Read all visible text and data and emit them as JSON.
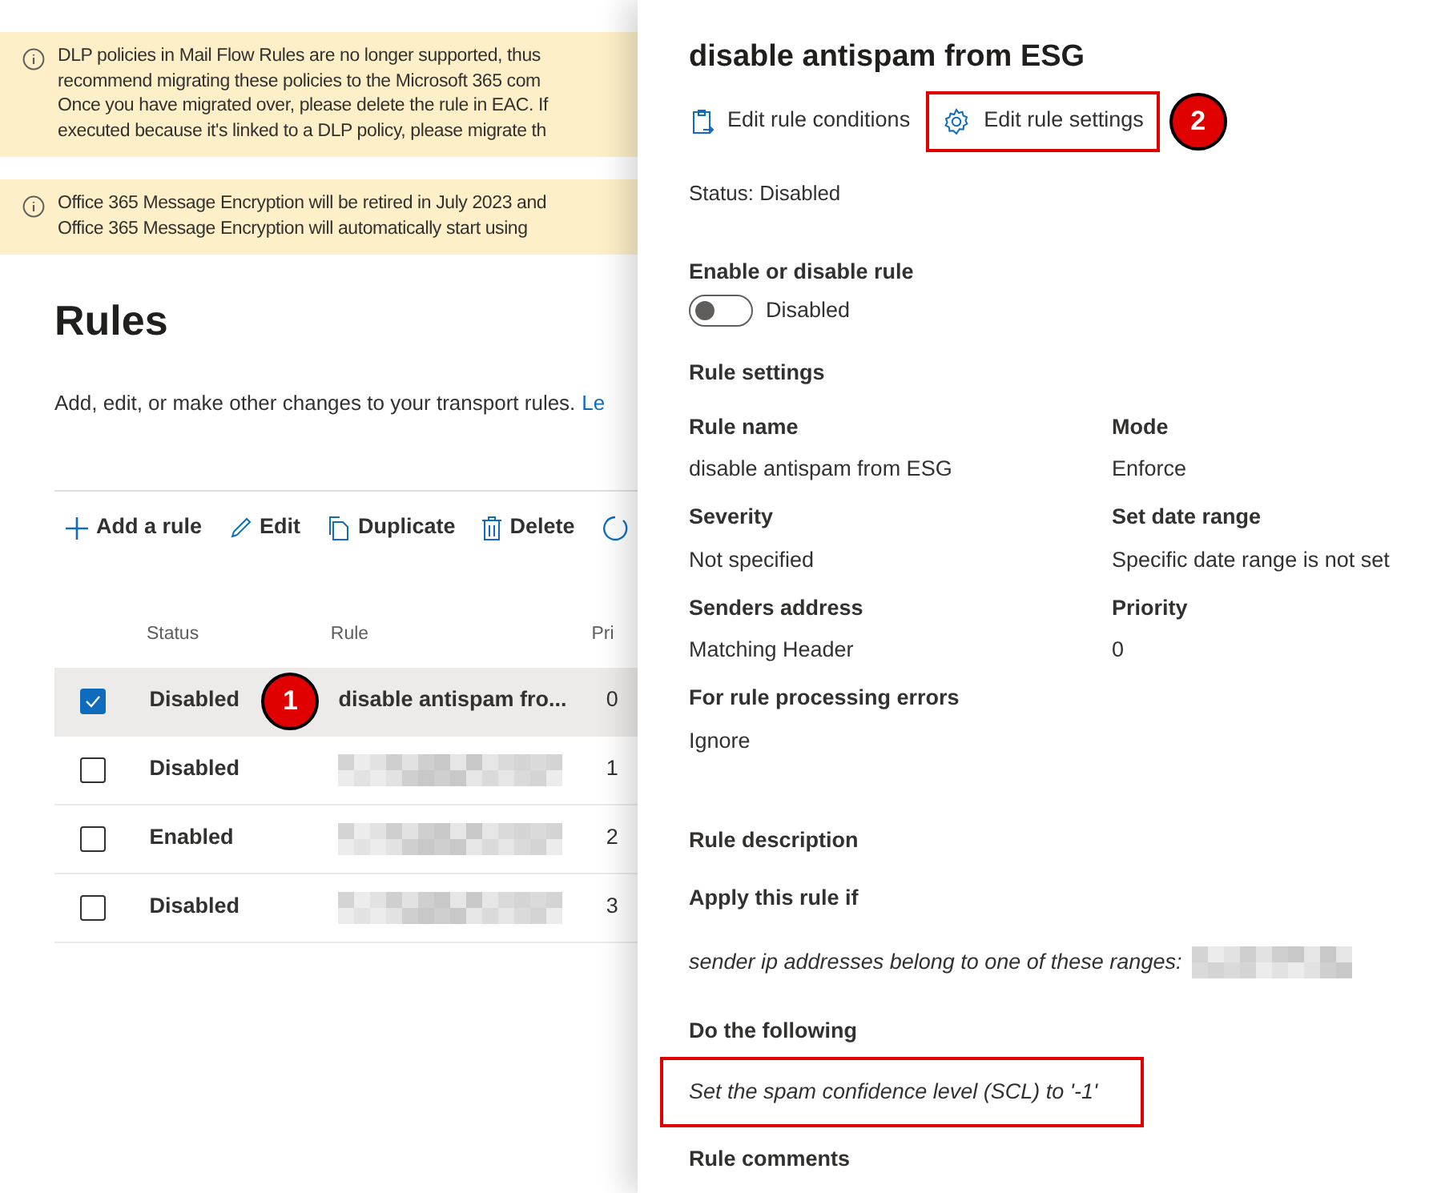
{
  "banners": [
    {
      "lines": [
        "DLP policies in Mail Flow Rules are no longer supported, thus",
        "recommend migrating these policies to the Microsoft 365 com",
        "Once you have migrated over, please delete the rule in EAC. If",
        "executed because it's linked to a DLP policy, please migrate th"
      ]
    },
    {
      "lines": [
        "Office 365 Message Encryption will be retired in July 2023 and",
        "Office 365 Message Encryption will automatically start using"
      ]
    }
  ],
  "page": {
    "title": "Rules",
    "description": "Add, edit, or make other changes to your transport rules.",
    "link": "Le"
  },
  "toolbar": [
    {
      "kind": "add",
      "label": "Add a rule"
    },
    {
      "kind": "edit",
      "label": "Edit"
    },
    {
      "kind": "duplicate",
      "label": "Duplicate"
    },
    {
      "kind": "delete",
      "label": "Delete"
    },
    {
      "kind": "refresh"
    }
  ],
  "table": {
    "columns": [
      "Status",
      "Rule",
      "Pri"
    ],
    "rows": [
      {
        "selected": true,
        "status": "Disabled",
        "rule": {
          "kind": "text",
          "text": "disable antispam fro..."
        },
        "priority": "0",
        "callout": "1"
      },
      {
        "selected": false,
        "status": "Disabled",
        "rule": {
          "kind": "redacted"
        },
        "priority": "1"
      },
      {
        "selected": false,
        "status": "Enabled",
        "rule": {
          "kind": "redacted"
        },
        "priority": "2"
      },
      {
        "selected": false,
        "status": "Disabled",
        "rule": {
          "kind": "redacted"
        },
        "priority": "3"
      }
    ]
  },
  "panel": {
    "title": "disable antispam from ESG",
    "actions": [
      {
        "kind": "conditions",
        "label": "Edit rule conditions",
        "highlighted": false
      },
      {
        "kind": "settings",
        "label": "Edit rule settings",
        "highlighted": true,
        "callout": "2"
      }
    ],
    "status": "Status: Disabled",
    "enable": {
      "label": "Enable or disable rule",
      "on": false,
      "state_text": "Disabled"
    },
    "settings_heading": "Rule settings",
    "settings": [
      {
        "label": "Rule name",
        "value": "disable antispam from ESG"
      },
      {
        "label": "Mode",
        "value": "Enforce"
      },
      {
        "label": "Severity",
        "value": "Not specified"
      },
      {
        "label": "Set date range",
        "value": "Specific date range is not set"
      },
      {
        "label": "Senders address",
        "value": "Matching Header"
      },
      {
        "label": "Priority",
        "value": "0"
      },
      {
        "label": "For rule processing errors",
        "value": "Ignore"
      }
    ],
    "description_heading": "Rule description",
    "condition_heading": "Apply this rule if",
    "condition": {
      "text": "sender ip addresses belong to one of these ranges:",
      "redacted": true
    },
    "action_heading": "Do the following",
    "action": {
      "text": "Set the spam confidence level (SCL) to '-1'",
      "highlighted": true
    },
    "comments_heading": "Rule comments"
  }
}
